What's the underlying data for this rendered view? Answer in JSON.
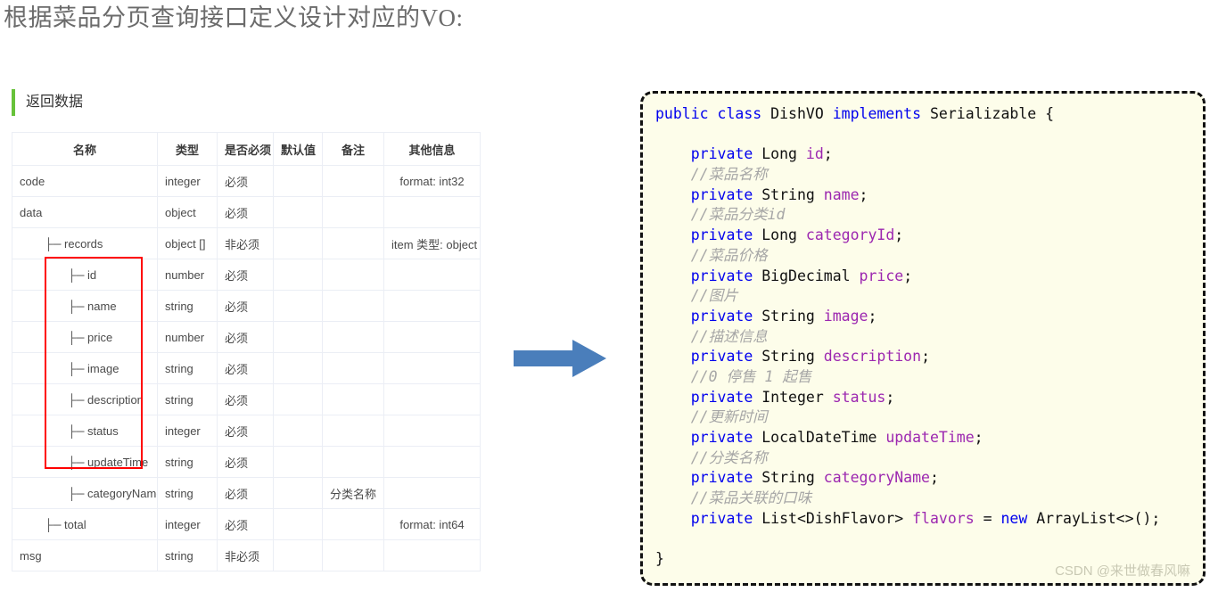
{
  "page": {
    "title": "根据菜品分页查询接口定义设计对应的VO:"
  },
  "section": {
    "heading": "返回数据",
    "accent_color": "#67c23a"
  },
  "table": {
    "headers": [
      "名称",
      "类型",
      "是否必须",
      "默认值",
      "备注",
      "其他信息"
    ],
    "rows": [
      {
        "indent": 0,
        "name": "code",
        "type": "integer",
        "required": "必须",
        "default": "",
        "note": "",
        "other": "format: int32"
      },
      {
        "indent": 0,
        "name": "data",
        "type": "object",
        "required": "必须",
        "default": "",
        "note": "",
        "other": ""
      },
      {
        "indent": 1,
        "name": "├─ records",
        "type": "object []",
        "required": "非必须",
        "default": "",
        "note": "",
        "other": "item 类型: object"
      },
      {
        "indent": 2,
        "name": "├─ id",
        "type": "number",
        "required": "必须",
        "default": "",
        "note": "",
        "other": ""
      },
      {
        "indent": 2,
        "name": "├─ name",
        "type": "string",
        "required": "必须",
        "default": "",
        "note": "",
        "other": ""
      },
      {
        "indent": 2,
        "name": "├─ price",
        "type": "number",
        "required": "必须",
        "default": "",
        "note": "",
        "other": ""
      },
      {
        "indent": 2,
        "name": "├─ image",
        "type": "string",
        "required": "必须",
        "default": "",
        "note": "",
        "other": ""
      },
      {
        "indent": 2,
        "name": "├─ description",
        "type": "string",
        "required": "必须",
        "default": "",
        "note": "",
        "other": ""
      },
      {
        "indent": 2,
        "name": "├─ status",
        "type": "integer",
        "required": "必须",
        "default": "",
        "note": "",
        "other": ""
      },
      {
        "indent": 2,
        "name": "├─ updateTime",
        "type": "string",
        "required": "必须",
        "default": "",
        "note": "",
        "other": ""
      },
      {
        "indent": 2,
        "name": "├─ categoryName",
        "type": "string",
        "required": "必须",
        "default": "",
        "note": "分类名称",
        "other": ""
      },
      {
        "indent": 1,
        "name": "├─ total",
        "type": "integer",
        "required": "必须",
        "default": "",
        "note": "",
        "other": "format: int64"
      },
      {
        "indent": 0,
        "name": "msg",
        "type": "string",
        "required": "非必须",
        "default": "",
        "note": "",
        "other": ""
      }
    ],
    "highlight": {
      "color": "#ff0000",
      "fields": [
        "id",
        "name",
        "price",
        "image",
        "description",
        "status",
        "updateTime",
        "categoryName"
      ]
    }
  },
  "arrow": {
    "icon": "right-arrow-icon",
    "color": "#4a7ebb",
    "direction": "right"
  },
  "code_panel": {
    "background": "#fdfdea",
    "border_color": "#111111",
    "language": "java",
    "class_name": "DishVO",
    "lines": [
      [
        {
          "t": "public",
          "c": "kw"
        },
        {
          "t": " ",
          "c": "pun"
        },
        {
          "t": "class",
          "c": "kw"
        },
        {
          "t": " ",
          "c": "pun"
        },
        {
          "t": "DishVO",
          "c": "type"
        },
        {
          "t": " ",
          "c": "pun"
        },
        {
          "t": "implements",
          "c": "kw"
        },
        {
          "t": " ",
          "c": "pun"
        },
        {
          "t": "Serializable",
          "c": "type"
        },
        {
          "t": " {",
          "c": "pun"
        }
      ],
      [
        {
          "t": "",
          "c": "pun"
        }
      ],
      [
        {
          "t": "    ",
          "c": "pun"
        },
        {
          "t": "private",
          "c": "kw"
        },
        {
          "t": " ",
          "c": "pun"
        },
        {
          "t": "Long",
          "c": "type"
        },
        {
          "t": " ",
          "c": "pun"
        },
        {
          "t": "id",
          "c": "var"
        },
        {
          "t": ";",
          "c": "pun"
        }
      ],
      [
        {
          "t": "    ",
          "c": "pun"
        },
        {
          "t": "//菜品名称",
          "c": "cmt"
        }
      ],
      [
        {
          "t": "    ",
          "c": "pun"
        },
        {
          "t": "private",
          "c": "kw"
        },
        {
          "t": " ",
          "c": "pun"
        },
        {
          "t": "String",
          "c": "type"
        },
        {
          "t": " ",
          "c": "pun"
        },
        {
          "t": "name",
          "c": "var"
        },
        {
          "t": ";",
          "c": "pun"
        }
      ],
      [
        {
          "t": "    ",
          "c": "pun"
        },
        {
          "t": "//菜品分类id",
          "c": "cmt"
        }
      ],
      [
        {
          "t": "    ",
          "c": "pun"
        },
        {
          "t": "private",
          "c": "kw"
        },
        {
          "t": " ",
          "c": "pun"
        },
        {
          "t": "Long",
          "c": "type"
        },
        {
          "t": " ",
          "c": "pun"
        },
        {
          "t": "categoryId",
          "c": "var"
        },
        {
          "t": ";",
          "c": "pun"
        }
      ],
      [
        {
          "t": "    ",
          "c": "pun"
        },
        {
          "t": "//菜品价格",
          "c": "cmt"
        }
      ],
      [
        {
          "t": "    ",
          "c": "pun"
        },
        {
          "t": "private",
          "c": "kw"
        },
        {
          "t": " ",
          "c": "pun"
        },
        {
          "t": "BigDecimal",
          "c": "type"
        },
        {
          "t": " ",
          "c": "pun"
        },
        {
          "t": "price",
          "c": "var"
        },
        {
          "t": ";",
          "c": "pun"
        }
      ],
      [
        {
          "t": "    ",
          "c": "pun"
        },
        {
          "t": "//图片",
          "c": "cmt"
        }
      ],
      [
        {
          "t": "    ",
          "c": "pun"
        },
        {
          "t": "private",
          "c": "kw"
        },
        {
          "t": " ",
          "c": "pun"
        },
        {
          "t": "String",
          "c": "type"
        },
        {
          "t": " ",
          "c": "pun"
        },
        {
          "t": "image",
          "c": "var"
        },
        {
          "t": ";",
          "c": "pun"
        }
      ],
      [
        {
          "t": "    ",
          "c": "pun"
        },
        {
          "t": "//描述信息",
          "c": "cmt"
        }
      ],
      [
        {
          "t": "    ",
          "c": "pun"
        },
        {
          "t": "private",
          "c": "kw"
        },
        {
          "t": " ",
          "c": "pun"
        },
        {
          "t": "String",
          "c": "type"
        },
        {
          "t": " ",
          "c": "pun"
        },
        {
          "t": "description",
          "c": "var"
        },
        {
          "t": ";",
          "c": "pun"
        }
      ],
      [
        {
          "t": "    ",
          "c": "pun"
        },
        {
          "t": "//0 停售 1 起售",
          "c": "cmt"
        }
      ],
      [
        {
          "t": "    ",
          "c": "pun"
        },
        {
          "t": "private",
          "c": "kw"
        },
        {
          "t": " ",
          "c": "pun"
        },
        {
          "t": "Integer",
          "c": "type"
        },
        {
          "t": " ",
          "c": "pun"
        },
        {
          "t": "status",
          "c": "var"
        },
        {
          "t": ";",
          "c": "pun"
        }
      ],
      [
        {
          "t": "    ",
          "c": "pun"
        },
        {
          "t": "//更新时间",
          "c": "cmt"
        }
      ],
      [
        {
          "t": "    ",
          "c": "pun"
        },
        {
          "t": "private",
          "c": "kw"
        },
        {
          "t": " ",
          "c": "pun"
        },
        {
          "t": "LocalDateTime",
          "c": "type"
        },
        {
          "t": " ",
          "c": "pun"
        },
        {
          "t": "updateTime",
          "c": "var"
        },
        {
          "t": ";",
          "c": "pun"
        }
      ],
      [
        {
          "t": "    ",
          "c": "pun"
        },
        {
          "t": "//分类名称",
          "c": "cmt"
        }
      ],
      [
        {
          "t": "    ",
          "c": "pun"
        },
        {
          "t": "private",
          "c": "kw"
        },
        {
          "t": " ",
          "c": "pun"
        },
        {
          "t": "String",
          "c": "type"
        },
        {
          "t": " ",
          "c": "pun"
        },
        {
          "t": "categoryName",
          "c": "var"
        },
        {
          "t": ";",
          "c": "pun"
        }
      ],
      [
        {
          "t": "    ",
          "c": "pun"
        },
        {
          "t": "//菜品关联的口味",
          "c": "cmt"
        }
      ],
      [
        {
          "t": "    ",
          "c": "pun"
        },
        {
          "t": "private",
          "c": "kw"
        },
        {
          "t": " ",
          "c": "pun"
        },
        {
          "t": "List<DishFlavor>",
          "c": "type"
        },
        {
          "t": " ",
          "c": "pun"
        },
        {
          "t": "flavors",
          "c": "var"
        },
        {
          "t": " = ",
          "c": "pun"
        },
        {
          "t": "new",
          "c": "kw"
        },
        {
          "t": " ",
          "c": "pun"
        },
        {
          "t": "ArrayList<>();",
          "c": "type"
        }
      ],
      [
        {
          "t": "",
          "c": "pun"
        }
      ],
      [
        {
          "t": "}",
          "c": "pun"
        }
      ]
    ]
  },
  "watermark": {
    "text": "CSDN @来世做春风嘛"
  }
}
